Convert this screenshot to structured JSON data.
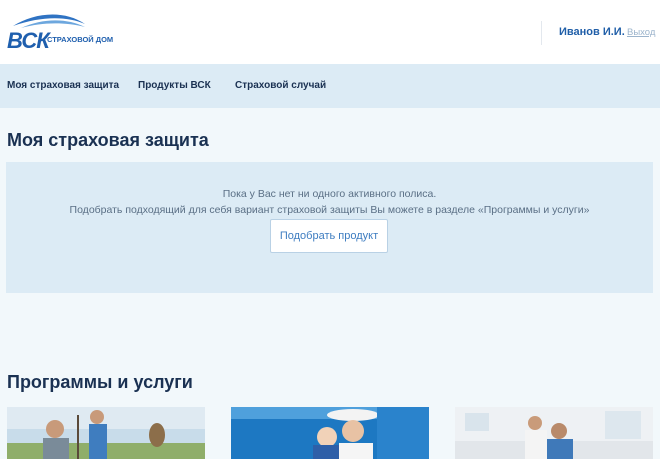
{
  "header": {
    "logo": {
      "brand": "ВСК",
      "tagline": "СТРАХОВОЙ ДОМ"
    },
    "user_name": "Иванов И.И.",
    "logout_label": "Выход"
  },
  "nav": {
    "items": [
      {
        "label": "Моя страховая защита"
      },
      {
        "label": "Продукты ВСК"
      },
      {
        "label": "Страховой случай"
      }
    ]
  },
  "protection": {
    "title": "Моя страховая защита",
    "empty_line1": "Пока у Вас нет ни одного активного полиса.",
    "empty_line2": "Подобрать подходящий для себя вариант страховой защиты Вы можете в разделе «Программы и услуги»",
    "button_label": "Подобрать продукт"
  },
  "programs": {
    "title": "Программы и услуги",
    "cards": [
      {
        "image": "family-fishing-photo"
      },
      {
        "image": "family-at-sea-photo"
      },
      {
        "image": "couple-at-home-photo"
      }
    ]
  },
  "colors": {
    "brand_blue": "#1f5fae",
    "nav_background": "#dcebf5",
    "page_background": "#f2f8fb",
    "text_dark": "#1a3152",
    "button_text": "#3d7cc0"
  }
}
